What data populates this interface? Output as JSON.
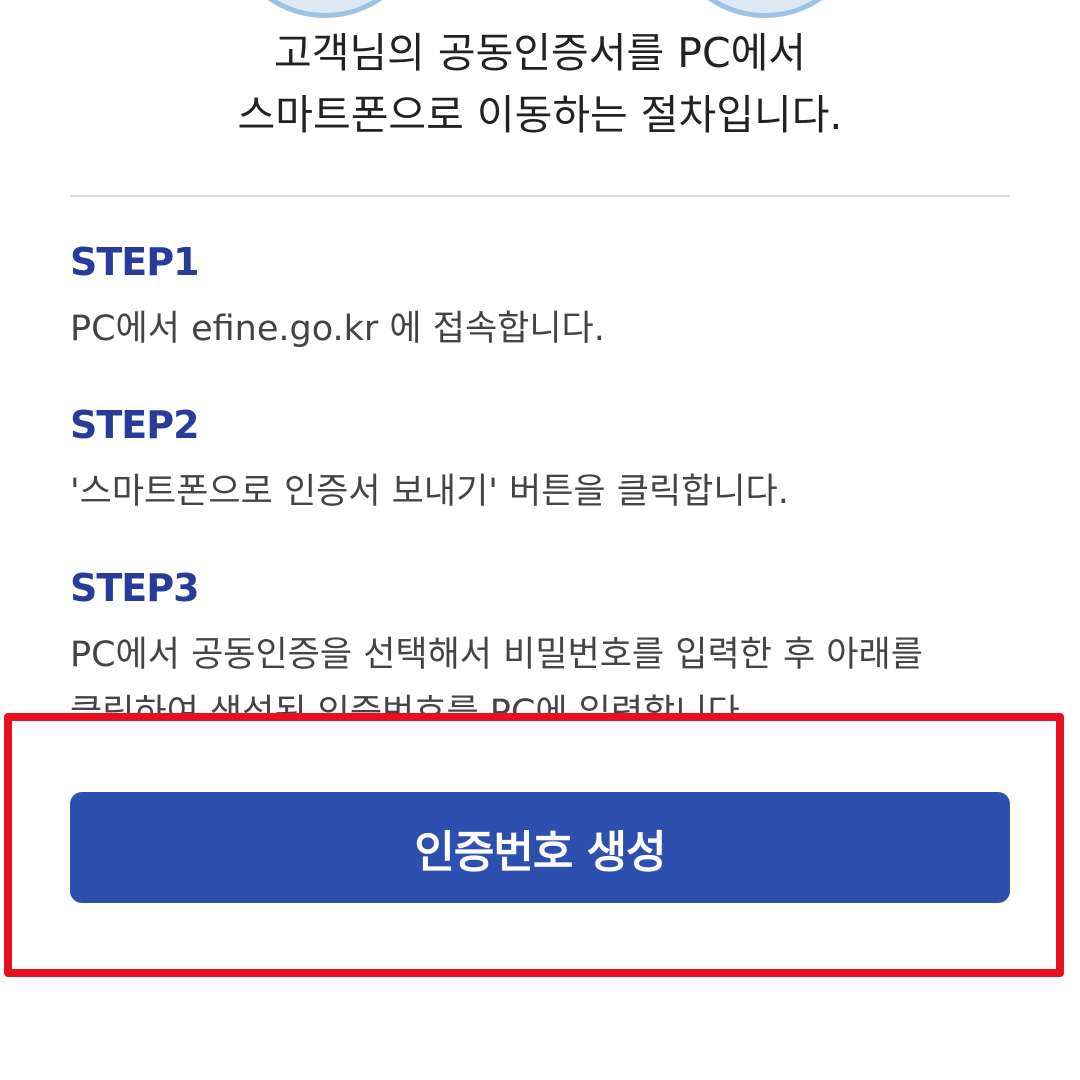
{
  "intro": {
    "line1": "고객님의 공동인증서를 PC에서",
    "line2": "스마트폰으로 이동하는 절차입니다."
  },
  "steps": [
    {
      "title": "STEP1",
      "desc": "PC에서 efine.go.kr 에 접속합니다."
    },
    {
      "title": "STEP2",
      "desc": "'스마트폰으로 인증서 보내기' 버튼을 클릭합니다."
    },
    {
      "title": "STEP3",
      "desc": "PC에서 공동인증을 선택해서 비밀번호를 입력한 후 아래를",
      "desc2": "클릭하여 생성된 인증번호를 PC에 입력합니다."
    }
  ],
  "button": {
    "label": "인증번호 생성"
  },
  "colors": {
    "accent": "#2d4fae",
    "step_title": "#283d9a",
    "highlight": "#e8101e",
    "deco_circle": "#9cc3e6"
  }
}
